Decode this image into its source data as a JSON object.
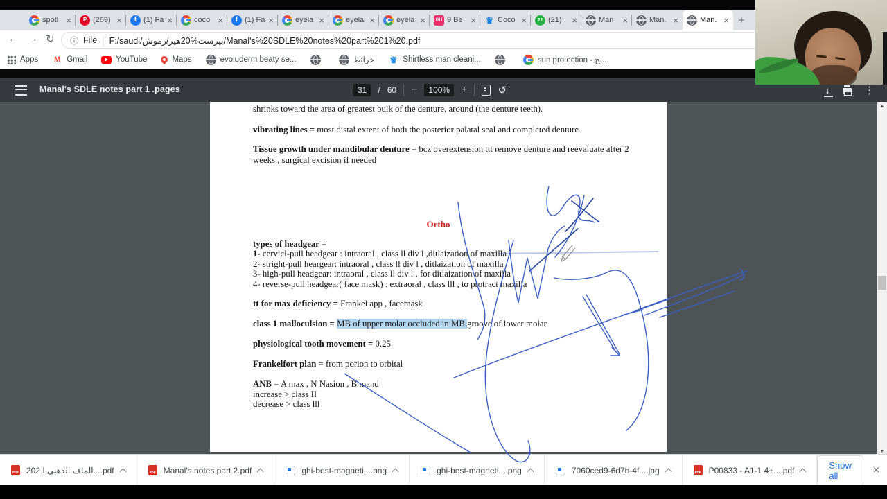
{
  "icons": {
    "close": "×",
    "back": "←",
    "forward": "→",
    "reload": "↻",
    "info": "ⓘ",
    "overflow": "⋮",
    "rotate": "↺",
    "minus": "−",
    "plus": "+",
    "new_tab": "+",
    "scroll_up": "▲",
    "scroll_down": "▼",
    "download": "↓",
    "divider": "|",
    "pinterest_glyph": "P",
    "facebook_glyph": "f",
    "github_glyph": "GH",
    "badge_21": "21",
    "crown_glyph": "♛",
    "gmail_glyph": "M"
  },
  "tabs": [
    {
      "label": "spotl"
    },
    {
      "label": "(269)"
    },
    {
      "label": "(1) Fa"
    },
    {
      "label": "coco"
    },
    {
      "label": "(1) Fa"
    },
    {
      "label": "eyela"
    },
    {
      "label": "eyela"
    },
    {
      "label": "eyela"
    },
    {
      "label": "9 Be"
    },
    {
      "label": "Coco"
    },
    {
      "label": "(21)"
    },
    {
      "label": "Man"
    },
    {
      "label": "Man."
    },
    {
      "label": "Man."
    }
  ],
  "address_bar": {
    "file_label": "File",
    "url": "F:/saudi/بيرست%20هير/رموش/Manal's%20SDLE%20notes%20part%201%20.pdf"
  },
  "bookmarks": {
    "items": [
      {
        "label": "Apps"
      },
      {
        "label": "Gmail"
      },
      {
        "label": "YouTube"
      },
      {
        "label": "Maps"
      },
      {
        "label": "evoluderm beaty se..."
      },
      {
        "label": ""
      },
      {
        "label": "خرائط"
      },
      {
        "label": "Shirtless man cleani..."
      },
      {
        "label": ""
      },
      {
        "label": "sun protection - بح..."
      }
    ]
  },
  "pdf_toolbar": {
    "title": "Manal's SDLE notes part 1 .pages",
    "page": "31",
    "page_sep": "/",
    "page_total": "60",
    "zoom": "100%"
  },
  "document": {
    "heading": "Ortho",
    "lines": [
      {
        "t": "shrinks toward the area of greatest bulk of the denture, around (the denture teeth)."
      },
      {
        "b": "vibrating lines = ",
        "t": "most distal extent of both the posterior palatal seal and completed denture"
      },
      {
        "b": "Tissue growth under mandibular denture = ",
        "t": "bcz overextension ttt remove denture and reevaluate after 2"
      },
      {
        "t": "weeks , surgical excision if needed"
      },
      {
        "b": "types of headgear ="
      },
      {
        "b": "1",
        "t": "- cervicl-pull headgear : intraoral , class ll div l  ,ditlaization of maxilla"
      },
      {
        "t": "2- stright-pull heargear: intraoral , class ll div l , ditlaization of maxilla"
      },
      {
        "t": "3- high-pull headgear: intraoral , class ll div l , for ditlaization of maxilla"
      },
      {
        "t": "4- reverse-pull headgear( face mask) :  extraoral , class lll , to protract maxilla"
      },
      {
        "b": "tt for max deficiency = ",
        "t": "Frankel app , facemask"
      },
      {
        "b": "class 1 malloculsion = ",
        "hl": "MB of upper molar occluded in MB ",
        "t": "groove of lower molar"
      },
      {
        "b": "physiological tooth movement = ",
        "t": "0.25"
      },
      {
        "b": "Frankelfort plan",
        "t": " = from porion to orbital"
      },
      {
        "b": "ANB",
        "t": " = A max , N Nasion , B mand"
      },
      {
        "t": "increase > class II"
      },
      {
        "t": "decrease > class lll"
      }
    ]
  },
  "downloads": {
    "items": [
      {
        "kind": "pdf",
        "name": "202 الماف الذهبي ا....pdf"
      },
      {
        "kind": "pdf",
        "name": "Manal's notes part 2.pdf"
      },
      {
        "kind": "image",
        "name": "ghi-best-magneti....png"
      },
      {
        "kind": "image",
        "name": "ghi-best-magneti....png"
      },
      {
        "kind": "image",
        "name": "7060ced9-6d7b-4f....jpg"
      },
      {
        "kind": "pdf",
        "name": "P00833 - A1-1 4+....pdf"
      }
    ],
    "show_all": "Show all"
  },
  "ink": {
    "color": "#3b5ec4",
    "color_dark": "#2b4aa0",
    "pencil_color": "#8a8a8a",
    "paths_blue": [
      "M792,269 C784,300 793,328 812,299 C826,276 841,275 836,299 C830,327 847,314 858,321",
      "M843,282 C837,312 822,347 801,371",
      "M734,347 C739,390 744,420 748,437 L761,372 L776,431 L791,359 C797,341 807,330 815,326",
      "M661,292 C667,352 687,402 698,442 C703,462 697,478 689,490",
      "M741,347 C717,426 696,506 701,561 C704,605 720,650 745,665 C760,672 770,655 762,636",
      "M497,539 C556,576 621,619 679,653",
      "M800,401 C830,407 862,400 876,393 C896,383 910,398 920,428 C933,470 940,515 933,560 C927,595 915,612 904,621",
      "M841,428 L889,508",
      "M846,425 L894,511",
      "M883,501 L894,513 L881,513",
      "M655,545 C730,515 850,472 965,432",
      "M920,447 C975,427 1030,407 1078,391",
      "M930,455 C985,434 1035,416 1074,396",
      "M1068,388 C1075,394 1077,401 1068,404",
      "M952,458 C990,445 1028,431 1060,420",
      "M897,455 L928,447"
    ],
    "paths_dark": [
      "M825,290 L864,320",
      "M856,286 C843,303 829,321 816,334",
      "M764,391 L834,330"
    ],
    "paths_faint": [
      "M719,366 L950,363"
    ],
    "paths_pencil": [
      "M826,354 L812,370",
      "M830,358 L816,374",
      "M816,374 L810,377 L812,370 Z"
    ]
  },
  "colors": {
    "tabstrip_bg": "#dee1e6",
    "toolbar_bg": "#36393d",
    "viewer_bg": "#4e5356",
    "highlight": "#b3d4ef",
    "heading_red": "#cc1f1f",
    "link_blue": "#1a73e8",
    "pdf_red": "#d93025"
  }
}
